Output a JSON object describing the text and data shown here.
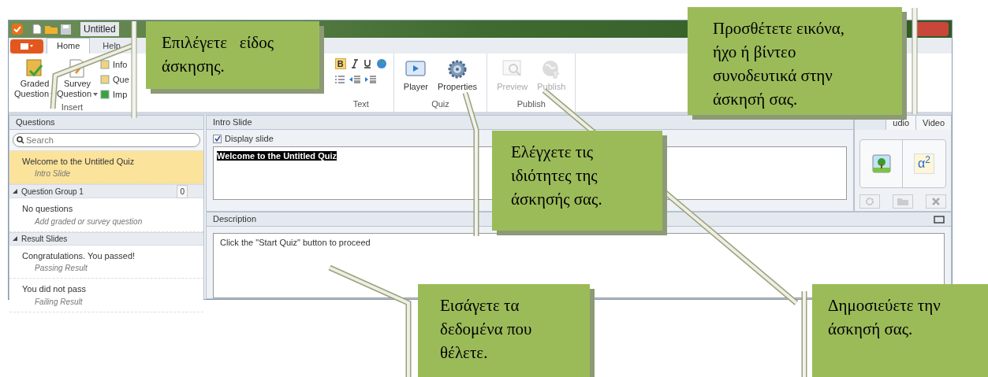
{
  "window": {
    "title": "Untitled"
  },
  "ribbon": {
    "app_menu_tabs": [
      {
        "label": "Home",
        "selected": true
      },
      {
        "label": "Help",
        "selected": false
      }
    ],
    "insert": {
      "label": "Insert",
      "big": [
        {
          "label": "Graded",
          "label2": "Question"
        },
        {
          "label": "Survey",
          "label2": "Question"
        }
      ],
      "small": [
        "Info",
        "Que",
        "Imp"
      ]
    },
    "text": {
      "label": "Text",
      "bold": "B"
    },
    "quiz": {
      "label": "Quiz",
      "buttons": [
        {
          "label": "Player",
          "kind": "player",
          "disabled": false
        },
        {
          "label": "Properties",
          "kind": "gear",
          "disabled": false
        }
      ]
    },
    "publish": {
      "label": "Publish",
      "buttons": [
        {
          "label": "Preview",
          "kind": "preview",
          "disabled": true
        },
        {
          "label": "Publish",
          "kind": "globe",
          "disabled": true
        }
      ]
    }
  },
  "questions_panel": {
    "title": "Questions",
    "search": {
      "placeholder": "Search"
    },
    "items": [
      {
        "kind": "item",
        "title": "Welcome to the Untitled Quiz",
        "subtitle": "Intro Slide",
        "selected": true
      },
      {
        "kind": "group",
        "title": "Question Group 1",
        "count": "0",
        "expanded": true
      },
      {
        "kind": "item",
        "title": "No questions",
        "subtitle": "Add graded or survey question",
        "selected": false
      },
      {
        "kind": "group",
        "title": "Result Slides",
        "expanded": true
      },
      {
        "kind": "item",
        "title": "Congratulations. You passed!",
        "subtitle": "Passing Result",
        "selected": false
      },
      {
        "kind": "item",
        "title": "You did not pass",
        "subtitle": "Failing Result",
        "selected": false
      }
    ]
  },
  "intro_slide": {
    "title": "Intro Slide",
    "display_slide": {
      "label": "Display slide",
      "checked": true
    },
    "text": "Welcome to the Untitled Quiz"
  },
  "media_panel": {
    "tabs": [
      {
        "label": "udio"
      },
      {
        "label": "Video"
      }
    ],
    "formula": "α$^{2}$"
  },
  "description": {
    "title": "Description",
    "text": "Click the \"Start Quiz\" button to proceed"
  },
  "callouts": [
    {
      "text": "Επιλέγετε   είδος\nάσκησης."
    },
    {
      "text": "Προσθέτετε εικόνα,\nήχο ή βίντεο\nσυνοδευτικά στην\nάσκησή σας."
    },
    {
      "text": "Ελέγχετε τις\nιδιότητες της\nάσκησής σας."
    },
    {
      "text": "Εισάγετε τα\nδεδομένα που\nθέλετε."
    },
    {
      "text": "Δημοσιεύετε την\nάσκησή σας."
    }
  ]
}
